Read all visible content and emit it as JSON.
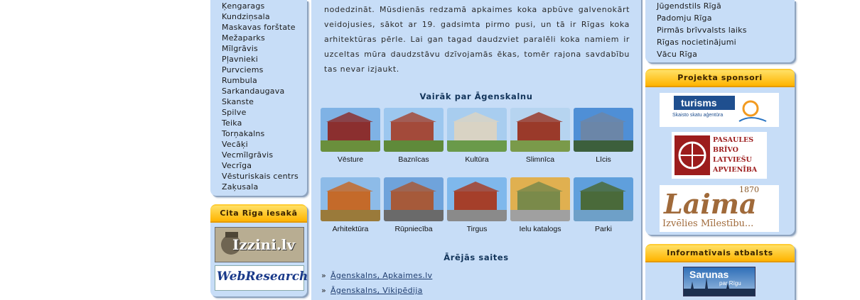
{
  "left_menu": {
    "items": [
      "Ķengarags",
      "Kundziņsala",
      "Maskavas forštate",
      "Mežaparks",
      "Mīlgrāvis",
      "Pļavnieki",
      "Purvciems",
      "Rumbula",
      "Sarkandaugava",
      "Skanste",
      "Spilve",
      "Teika",
      "Torņakalns",
      "Vecāķi",
      "Vecmīlgrāvis",
      "Vecrīga",
      "Vēsturiskais centrs",
      "Zaķusala"
    ]
  },
  "other_riga": {
    "title": "Cita Rīga iesakā",
    "items": [
      {
        "label": "Izzini.lv"
      },
      {
        "label": "WebResearch"
      }
    ]
  },
  "article": {
    "paragraph": "nodedzināt. Mūsdienās redzamā apkaimes koka apbūve galvenokārt veidojusies, sākot ar 19. gadsimta pirmo pusi, un tā ir Rīgas koka arhitektūras pērle. Lai gan tagad daudzviet paralēli koka namiem ir uzceltas mūra daudzstāvu dzīvojamās ēkas, tomēr rajona savdabību tas nevar izjaukt."
  },
  "gallery": {
    "title": "Vairāk par Āgenskalnu",
    "items": [
      {
        "label": "Vēsture"
      },
      {
        "label": "Baznīcas"
      },
      {
        "label": "Kultūra"
      },
      {
        "label": "Slimnīca"
      },
      {
        "label": "Līcis"
      },
      {
        "label": "Arhitektūra"
      },
      {
        "label": "Rūpniecība"
      },
      {
        "label": "Tirgus"
      },
      {
        "label": "Ielu katalogs"
      },
      {
        "label": "Parki"
      }
    ]
  },
  "external_links": {
    "title": "Ārējās saites",
    "bullet": "»",
    "items": [
      {
        "label": "Āgenskalns, Apkaimes.lv"
      },
      {
        "label": "Āgenskalns, Vikipēdija"
      }
    ]
  },
  "right_menu": {
    "items": [
      "Jūgendstils Rīgā",
      "Padomju Rīga",
      "Pirmās brīvvalsts laiks",
      "Rīgas nocietinājumi",
      "Vācu Rīga"
    ]
  },
  "sponsors": {
    "title": "Projekta sponsori",
    "items": [
      {
        "name": "turisms",
        "tagline": "Skaisto skatu aģentūra"
      },
      {
        "name_lines": [
          "PASAULES",
          "BRĪVO",
          "LATVIEŠU",
          "APVIENĪBA"
        ]
      },
      {
        "name": "Laima",
        "year": "1870",
        "tagline": "Izvēlies Mīlestību..."
      }
    ]
  },
  "info_support": {
    "title": "Informatīvais atbalsts",
    "logo_lines": [
      "Sarunas",
      "par Rīgu"
    ]
  },
  "colors": {
    "panel_bg": "#c7ddf7",
    "heading_orange": "#ffb400",
    "link_blue": "#1e3c6e"
  }
}
